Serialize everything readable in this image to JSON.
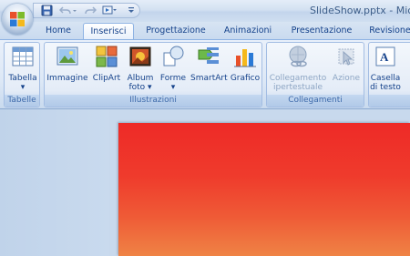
{
  "window": {
    "title": "SlideShow.pptx - Mic"
  },
  "tabs": [
    {
      "label": "Home",
      "active": false
    },
    {
      "label": "Inserisci",
      "active": true
    },
    {
      "label": "Progettazione",
      "active": false
    },
    {
      "label": "Animazioni",
      "active": false
    },
    {
      "label": "Presentazione",
      "active": false
    },
    {
      "label": "Revisione",
      "active": false
    }
  ],
  "ribbon": {
    "groups": [
      {
        "label": "Tabelle",
        "buttons": [
          {
            "label": "Tabella",
            "has_dropdown": true,
            "icon": "table-icon"
          }
        ]
      },
      {
        "label": "Illustrazioni",
        "buttons": [
          {
            "label": "Immagine",
            "icon": "picture-icon"
          },
          {
            "label": "ClipArt",
            "icon": "clipart-icon"
          },
          {
            "label": "Album",
            "label2": "foto",
            "has_dropdown": true,
            "icon": "photo-album-icon"
          },
          {
            "label": "Forme",
            "has_dropdown": true,
            "icon": "shapes-icon"
          },
          {
            "label": "SmartArt",
            "icon": "smartart-icon"
          },
          {
            "label": "Grafico",
            "icon": "chart-icon"
          }
        ]
      },
      {
        "label": "Collegamenti",
        "buttons": [
          {
            "label": "Collegamento",
            "label2": "ipertestuale",
            "icon": "hyperlink-icon",
            "disabled": true
          },
          {
            "label": "Azione",
            "icon": "action-icon",
            "disabled": true
          }
        ]
      },
      {
        "label": "",
        "buttons": [
          {
            "label": "Casella",
            "label2": "di testo",
            "icon": "textbox-icon"
          }
        ]
      }
    ]
  },
  "colors": {
    "ribbon_text": "#15428b",
    "slide_top": "#ee2a27",
    "slide_bottom": "#ef8345"
  }
}
